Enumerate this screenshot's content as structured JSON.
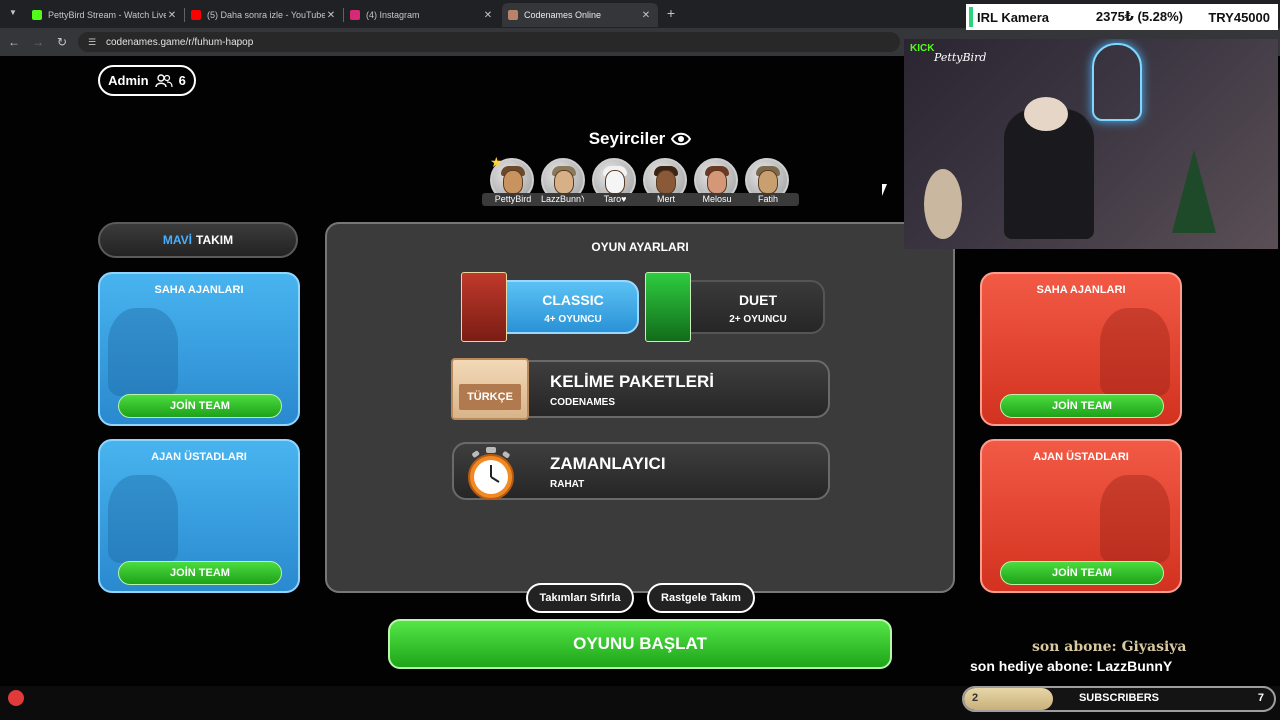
{
  "browser": {
    "tabs": [
      {
        "title": "PettyBird Stream - Watch Live o",
        "favicon_color": "#53fc18",
        "active": false
      },
      {
        "title": "(5) Daha sonra izle - YouTube",
        "favicon_color": "#ff0000",
        "active": false
      },
      {
        "title": "(4) Instagram",
        "favicon_color": "#d62976",
        "active": false
      },
      {
        "title": "Codenames Online",
        "favicon_color": "#b9826a",
        "active": true
      }
    ],
    "new_tab": "+",
    "close_glyph": "✕",
    "url": "codenames.game/r/fuhum-hapop"
  },
  "ticker": {
    "label": "IRL Kamera",
    "value": "2375₺ (5.28%)",
    "goal": "TRY45000",
    "accent": "#2ad47a"
  },
  "game": {
    "admin_label": "Admin",
    "player_count": "6",
    "spectators_title": "Seyirciler",
    "spectators": [
      "PettyBird",
      "LazzBunnY",
      "Taro♥",
      "Mert",
      "Melosu",
      "Fatih"
    ],
    "blue_team": {
      "name_colored": "MAVİ",
      "name_rest": "TAKIM",
      "color": "#2a89cf"
    },
    "red_team": {
      "color": "#d2321f"
    },
    "field_agents": "SAHA AJANLARI",
    "spymasters": "AJAN ÜSTADLARI",
    "join_label": "JOİN TEAM",
    "settings": {
      "title": "OYUN AYARLARI",
      "modes": [
        {
          "name": "CLASSIC",
          "players": "4+ OYUNCU",
          "selected": true
        },
        {
          "name": "DUET",
          "players": "2+ OYUNCU",
          "selected": false
        }
      ],
      "word_pack_title": "KELİME PAKETLERİ",
      "word_pack_value": "CODENAMES",
      "word_pack_sign": "TÜRKÇE",
      "timer_title": "ZAMANLAYICI",
      "timer_value": "RAHAT",
      "reset_teams": "Takımları Sıfırla",
      "random_teams": "Rastgele Takım"
    },
    "start_button": "OYUNU BAŞLAT"
  },
  "stream": {
    "kick_logo": "KICK",
    "kick_name": "PettyBird",
    "last_sub": "son abone: Giyasiya",
    "last_gift_sub": "son hediye abone: LazzBunnY",
    "subs_label": "SUBSCRIBERS",
    "subs_current": "2",
    "subs_goal": "7",
    "subs_progress": 0.286
  }
}
